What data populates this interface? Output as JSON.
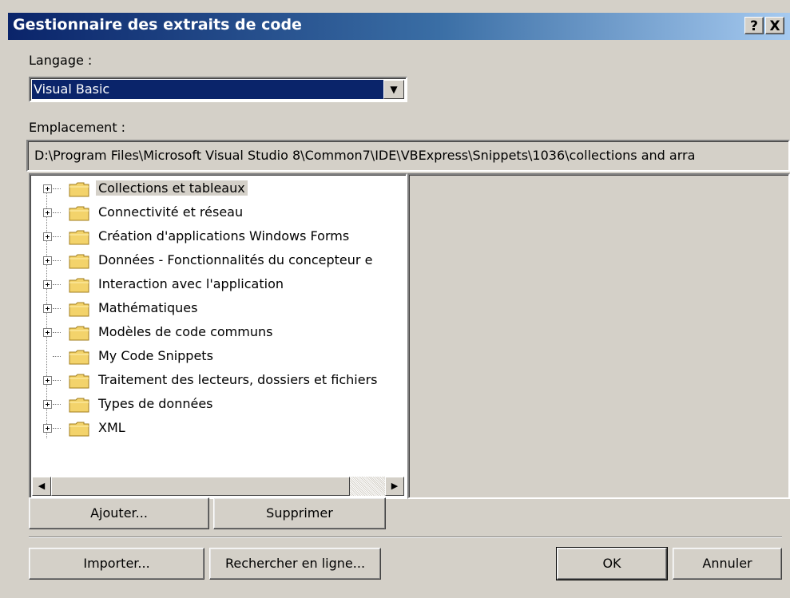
{
  "window": {
    "title": "Gestionnaire des extraits de code",
    "help_glyph": "?",
    "close_glyph": "X"
  },
  "language": {
    "label": "Langage :",
    "value": "Visual Basic",
    "dropdown_glyph": "▼"
  },
  "location": {
    "label": "Emplacement :",
    "path": "D:\\Program Files\\Microsoft Visual Studio 8\\Common7\\IDE\\VBExpress\\Snippets\\1036\\collections and arra"
  },
  "tree": {
    "items": [
      {
        "label": "Collections et tableaux",
        "selected": true,
        "expandable": true
      },
      {
        "label": "Connectivité et réseau",
        "expandable": true
      },
      {
        "label": "Création d'applications Windows Forms",
        "expandable": true
      },
      {
        "label": "Données - Fonctionnalités du concepteur e",
        "expandable": true
      },
      {
        "label": "Interaction avec l'application",
        "expandable": true
      },
      {
        "label": "Mathématiques",
        "expandable": true
      },
      {
        "label": "Modèles de code communs",
        "expandable": true
      },
      {
        "label": "My Code Snippets",
        "expandable": false
      },
      {
        "label": "Traitement des lecteurs, dossiers et fichiers",
        "expandable": true
      },
      {
        "label": "Types de données",
        "expandable": true
      },
      {
        "label": "XML",
        "expandable": true
      }
    ],
    "scroll_left_glyph": "◀",
    "scroll_right_glyph": "▶"
  },
  "buttons": {
    "add": "Ajouter...",
    "remove": "Supprimer",
    "import": "Importer...",
    "search_online": "Rechercher en ligne...",
    "ok": "OK",
    "cancel": "Annuler"
  },
  "colors": {
    "titlebar_start": "#0a246a",
    "titlebar_end": "#a6caf0",
    "face": "#d4d0c8",
    "selection": "#0a246a"
  },
  "icons": [
    "help-icon",
    "close-icon",
    "dropdown-arrow-icon",
    "expand-icon",
    "folder-icon",
    "scroll-left-icon",
    "scroll-right-icon"
  ]
}
